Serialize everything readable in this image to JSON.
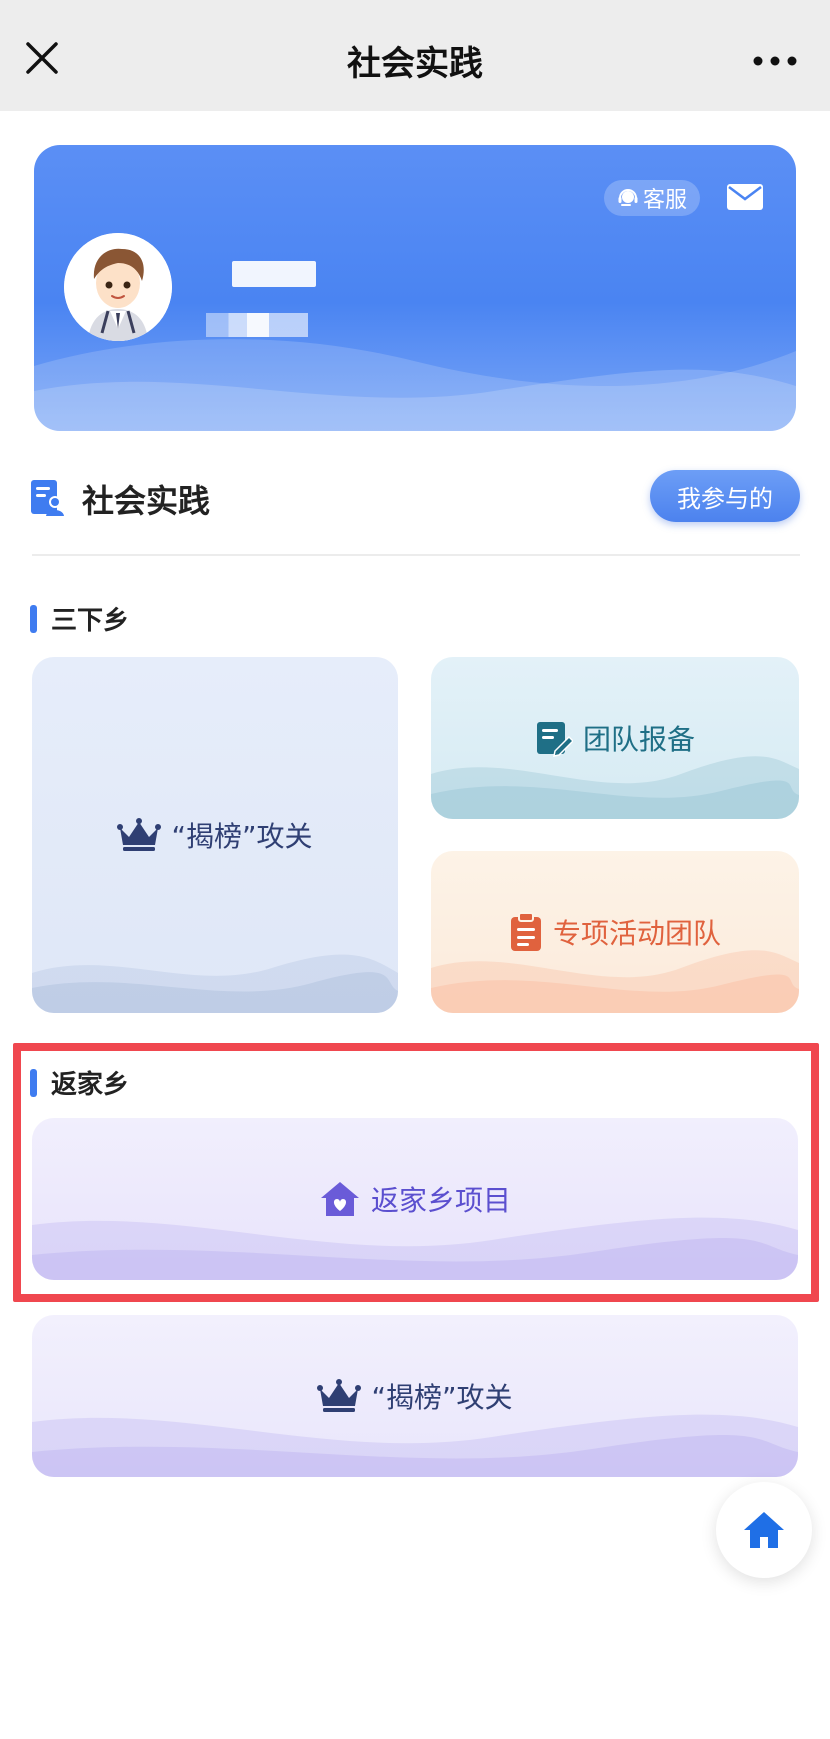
{
  "nav": {
    "title": "社会实践",
    "close_icon": "close-icon",
    "more_icon": "more-icon"
  },
  "profile": {
    "service_label": "客服",
    "service_icon": "headset-icon",
    "mail_icon": "mail-icon",
    "avatar_icon": "avatar-illustration"
  },
  "section": {
    "title": "社会实践",
    "icon": "people-list-icon",
    "mine_button": "我参与的"
  },
  "sanxiaxiang": {
    "heading": "三下乡",
    "tiles": [
      {
        "label": "“揭榜”攻关",
        "icon": "crown-icon"
      },
      {
        "label": "团队报备",
        "icon": "edit-document-icon"
      },
      {
        "label": "专项活动团队",
        "icon": "clipboard-icon"
      }
    ]
  },
  "fanjiaxiang": {
    "heading": "返家乡",
    "tiles": [
      {
        "label": "返家乡项目",
        "icon": "house-heart-icon"
      },
      {
        "label": "“揭榜”攻关",
        "icon": "crown-icon"
      }
    ]
  },
  "fab": {
    "icon": "home-icon"
  },
  "colors": {
    "accent": "#3f7cf0",
    "highlight": "#f0474f"
  }
}
